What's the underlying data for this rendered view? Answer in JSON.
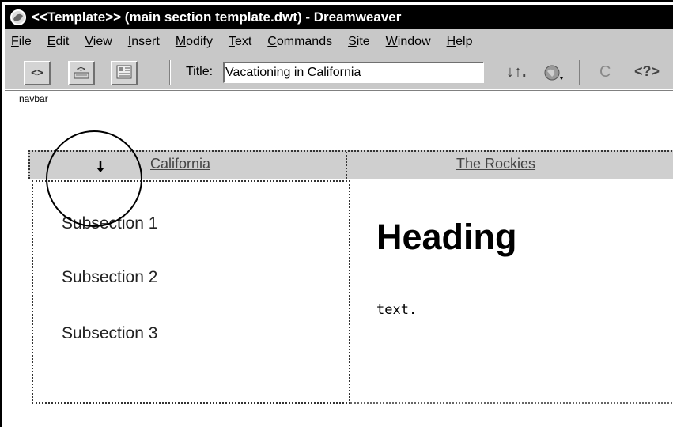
{
  "window": {
    "title": "<<Template>>  (main section template.dwt) - Dreamweaver"
  },
  "menubar": {
    "items": [
      {
        "acc": "F",
        "rest": "ile"
      },
      {
        "acc": "E",
        "rest": "dit"
      },
      {
        "acc": "V",
        "rest": "iew"
      },
      {
        "acc": "I",
        "rest": "nsert"
      },
      {
        "acc": "M",
        "rest": "odify"
      },
      {
        "acc": "T",
        "rest": "ext"
      },
      {
        "acc": "C",
        "rest": "ommands"
      },
      {
        "acc": "S",
        "rest": "ite"
      },
      {
        "acc": "W",
        "rest": "indow"
      },
      {
        "acc": "H",
        "rest": "elp"
      }
    ]
  },
  "toolbar": {
    "code_view_icon": "<>",
    "split_view_icon": "<>",
    "design_view_icon": "design-view-icon",
    "title_label": "Title:",
    "title_value": "Vacationing in California",
    "file_mgmt_icon": "↓↑.",
    "preview_icon": "globe-icon",
    "refresh_icon": "C",
    "reference_icon": "<?>"
  },
  "document": {
    "navbar_tag": "navbar",
    "nav_links": [
      "California",
      "The Rockies"
    ],
    "subsections": [
      "Subsection 1",
      "Subsection 2",
      "Subsection 3"
    ],
    "heading": "Heading",
    "body_text": "text."
  },
  "colors": {
    "titlebar": "#000000",
    "chrome": "#c8c8c8",
    "navbar_bg": "#cfcfcf"
  }
}
